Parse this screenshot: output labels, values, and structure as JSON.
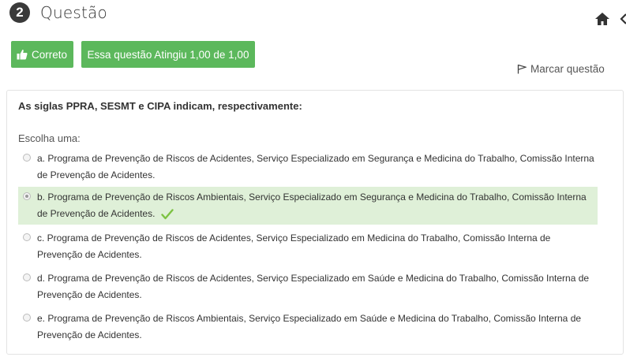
{
  "question": {
    "number": "2",
    "title": "Questão"
  },
  "badges": {
    "correct_label": "Correto",
    "grade_label": "Essa questão Atingiu 1,00 de 1,00",
    "color": "#5cb85c"
  },
  "flag_label": "Marcar questão",
  "content": {
    "question_text": "As siglas PPRA, SESMT e CIPA indicam, respectivamente:",
    "prompt": "Escolha uma:",
    "options": [
      {
        "text": "a. Programa de Prevenção de Riscos de Acidentes, Serviço Especializado em Segurança e Medicina do Trabalho, Comissão Interna de Prevenção de Acidentes.",
        "selected": false
      },
      {
        "text": "b. Programa de Prevenção de Riscos Ambientais, Serviço Especializado em Segurança e Medicina do Trabalho, Comissão Interna de Prevenção de Acidentes.",
        "selected": true,
        "correct": true
      },
      {
        "text": "c. Programa de Prevenção de Riscos de Acidentes, Serviço Especializado em Medicina do Trabalho, Comissão Interna de Prevenção de Acidentes.",
        "selected": false
      },
      {
        "text": "d. Programa de Prevenção de Riscos de Acidentes, Serviço Especializado em Saúde e Medicina do Trabalho, Comissão Interna de Prevenção de Acidentes.",
        "selected": false
      },
      {
        "text": "e. Programa de Prevenção de Riscos Ambientais, Serviço Especializado em Saúde e Medicina do Trabalho, Comissão Interna de Prevenção de Acidentes.",
        "selected": false
      }
    ]
  },
  "icons": [
    "home-icon",
    "chevron-left-icon",
    "thumbs-up-icon",
    "flag-icon",
    "checkmark-icon"
  ],
  "colors": {
    "selected_bg": "#dff0d8",
    "check": "#7cc242"
  }
}
